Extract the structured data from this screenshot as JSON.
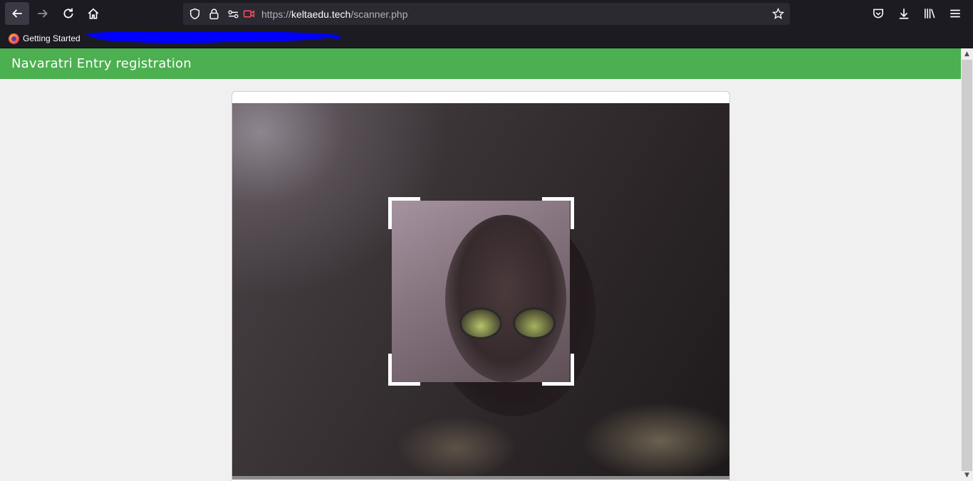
{
  "browser": {
    "nav": {
      "back_icon": "arrow-left-icon",
      "forward_icon": "arrow-right-icon",
      "reload_icon": "reload-icon",
      "home_icon": "home-icon"
    },
    "url": {
      "prefix": "https://",
      "domain": "keltaedu.tech",
      "path": "/scanner.php"
    },
    "right_icons": [
      "pocket-icon",
      "download-icon",
      "library-icon",
      "menu-icon"
    ],
    "bookmarks": [
      {
        "label": "Getting Started",
        "icon": "firefox-icon"
      }
    ],
    "colors": {
      "chrome": "#1c1b22",
      "urlbar": "#2b2a33",
      "redaction": "#0000ff"
    }
  },
  "page": {
    "header": {
      "title": "Navaratri Entry registration",
      "color": "#4caf50"
    },
    "scanner": {
      "state": "camera live, scanning region shown",
      "corner_color": "#ffffff"
    }
  }
}
